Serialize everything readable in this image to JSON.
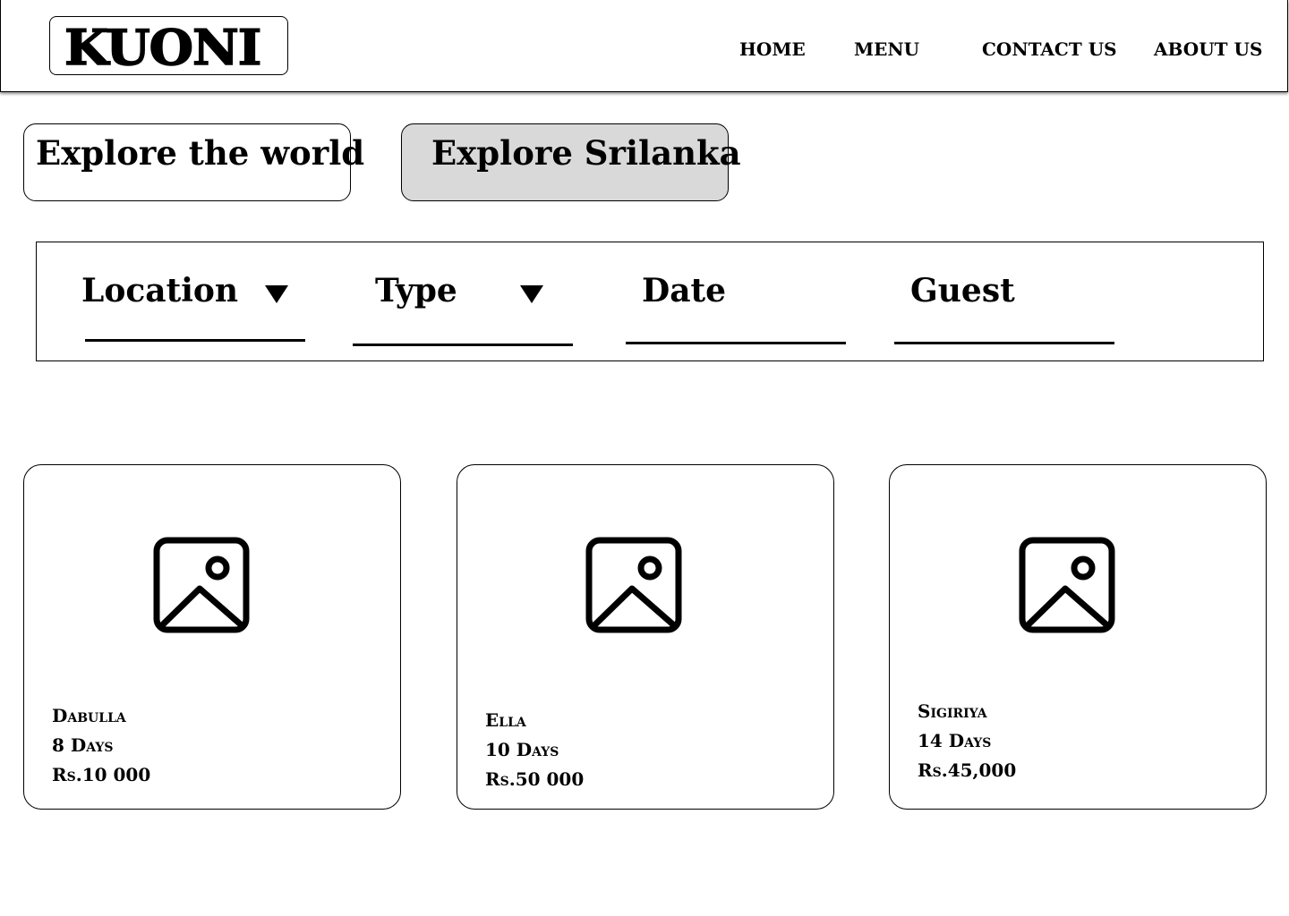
{
  "header": {
    "logo": "KUONI",
    "nav": [
      "HOME",
      "MENU",
      "CONTACT US",
      "ABOUT US"
    ]
  },
  "tabs": [
    {
      "label": "Explore the world",
      "selected": false
    },
    {
      "label": "Explore Srilanka",
      "selected": true
    }
  ],
  "filters": [
    {
      "label": "Location",
      "icon": "dropdown-arrow-icon"
    },
    {
      "label": "Type",
      "icon": "dropdown-arrow-icon"
    },
    {
      "label": "Date"
    },
    {
      "label": "Guest"
    }
  ],
  "cards": [
    {
      "name": "Dabulla",
      "duration": "8 Days",
      "price": "Rs.10 000",
      "icon": "image-placeholder-icon"
    },
    {
      "name": "Ella",
      "duration": "10 Days",
      "price": "Rs.50 000",
      "icon": "image-placeholder-icon"
    },
    {
      "name": "Sigiriya",
      "duration": "14 Days",
      "price": "Rs.45,000",
      "icon": "image-placeholder-icon"
    }
  ],
  "colors": {
    "selected_tab_bg": "#d9d9d9",
    "border": "#000000",
    "background": "#ffffff"
  }
}
